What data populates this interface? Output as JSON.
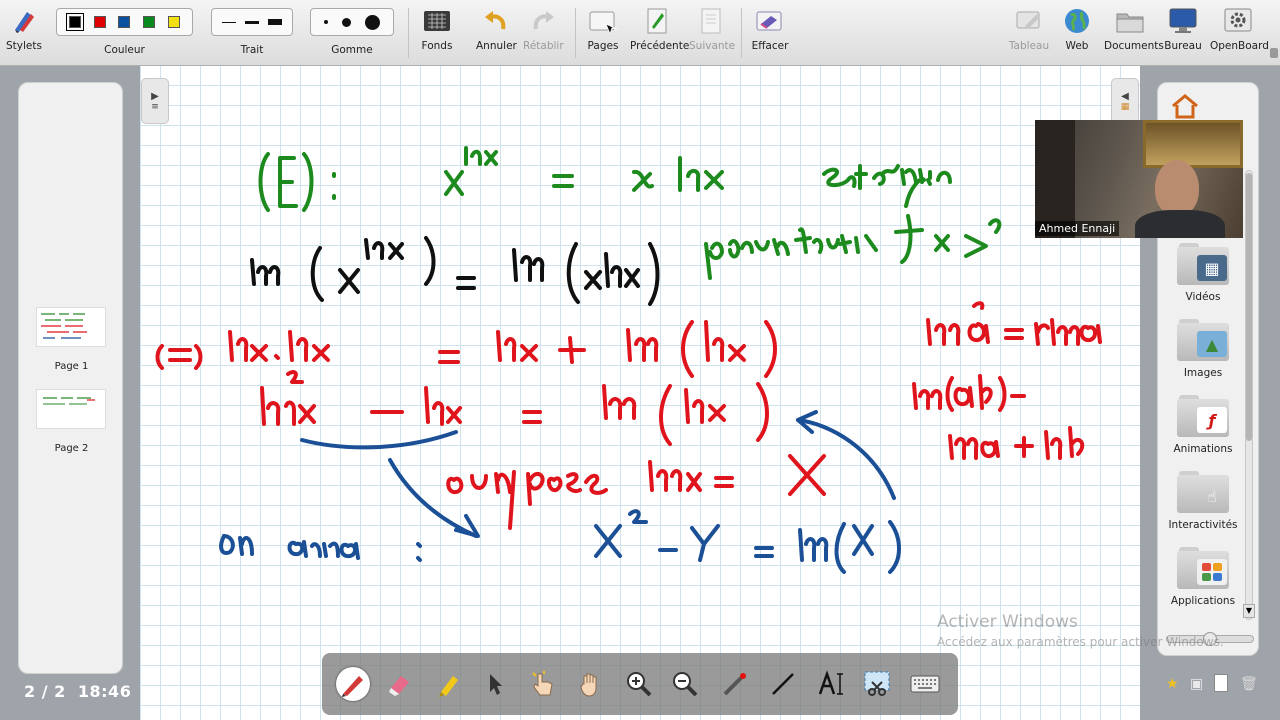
{
  "toolbar": {
    "stylets": "Stylets",
    "couleur": "Couleur",
    "trait": "Trait",
    "gomme": "Gomme",
    "fonds": "Fonds",
    "annuler": "Annuler",
    "retablir": "Rétablir",
    "pages": "Pages",
    "precedente": "Précédente",
    "suivante": "Suivante",
    "effacer": "Effacer",
    "tableau": "Tableau",
    "web": "Web",
    "documents": "Documents",
    "bureau": "Bureau",
    "openboard": "OpenBoard",
    "colors": [
      "#000000",
      "#e00000",
      "#0a4fa0",
      "#0a8a1e",
      "#f2e014"
    ]
  },
  "pages_panel": {
    "pages": [
      {
        "label": "Page 1"
      },
      {
        "label": "Page 2"
      }
    ],
    "counter": "2 / 2",
    "time": "18:46"
  },
  "library": {
    "items": [
      {
        "label": "Vidéos",
        "icon": "film-icon"
      },
      {
        "label": "Images",
        "icon": "image-icon"
      },
      {
        "label": "Animations",
        "icon": "flash-icon"
      },
      {
        "label": "Interactivités",
        "icon": "hand-icon"
      },
      {
        "label": "Applications",
        "icon": "apps-icon"
      }
    ]
  },
  "video": {
    "participant_name": "Ahmed Ennaji"
  },
  "watermark": {
    "title": "Activer Windows",
    "subtitle": "Accédez aux paramètres pour activer Windows."
  },
  "board": {
    "ink_colors": {
      "green": "#1d8a1d",
      "black": "#101010",
      "red": "#e0141c",
      "blue": "#1b4f96"
    }
  }
}
